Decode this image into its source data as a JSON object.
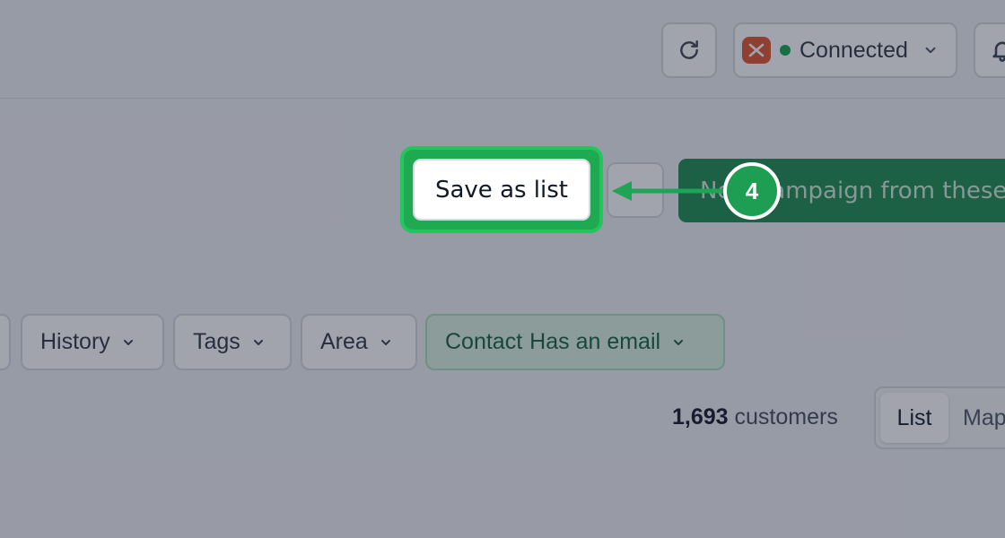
{
  "header": {
    "connection_status": "Connected",
    "icons": {
      "refresh": "refresh-icon",
      "app_logo": "app-logo-icon",
      "status_dot": "status-dot",
      "chevron": "chevron-down-icon",
      "bell": "bell-icon"
    }
  },
  "actions": {
    "save_as_list": "Save as list",
    "new_campaign": "New campaign from these customers"
  },
  "tutorial": {
    "step_number": "4",
    "highlight_color": "#22c55e"
  },
  "filters": [
    {
      "label": "History"
    },
    {
      "label": "Tags"
    },
    {
      "label": "Area"
    },
    {
      "label": "Contact",
      "value": "Has an email"
    }
  ],
  "results": {
    "count": "1,693",
    "count_label": "customers",
    "view_options": [
      "List",
      "Map"
    ],
    "active_view": "List"
  },
  "colors": {
    "primary_green": "#1a8a4f",
    "status_connected": "#16a34a",
    "app_logo": "#e0532e"
  }
}
